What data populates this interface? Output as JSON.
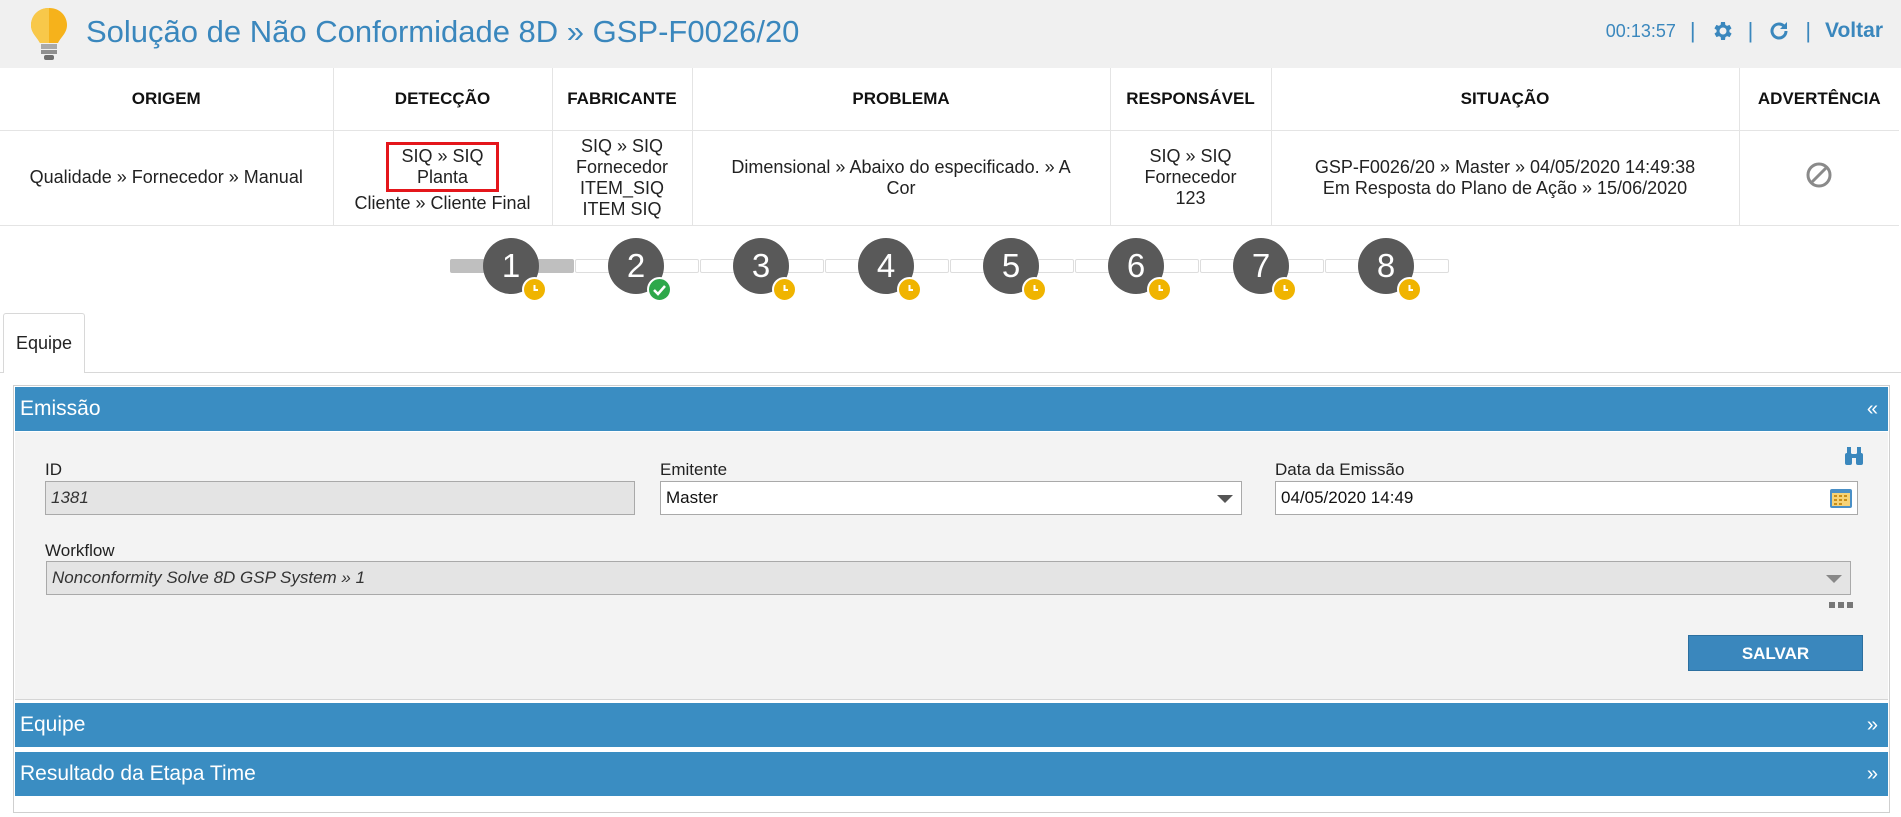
{
  "header": {
    "title": "Solução de Não Conformidade 8D » GSP-F0026/20",
    "timer": "00:13:57",
    "back_label": "Voltar",
    "icons": [
      "lightbulb-icon",
      "gear-icon",
      "refresh-icon"
    ]
  },
  "summary": {
    "columns": [
      "ORIGEM",
      "DETECÇÃO",
      "FABRICANTE",
      "PROBLEMA",
      "RESPONSÁVEL",
      "SITUAÇÃO",
      "ADVERTÊNCIA"
    ],
    "origem": "Qualidade » Fornecedor » Manual",
    "deteccao_line1": "SIQ » SIQ",
    "deteccao_line2": "Planta",
    "deteccao_line3": "Cliente » Cliente Final",
    "fabricante_line1": "SIQ » SIQ",
    "fabricante_line2": "Fornecedor",
    "fabricante_line3": "ITEM_SIQ",
    "fabricante_line4": "ITEM SIQ",
    "problema_line1": "Dimensional » Abaixo do especificado. » A",
    "problema_line2": "Cor",
    "responsavel_line1": "SIQ » SIQ",
    "responsavel_line2": "Fornecedor",
    "responsavel_line3": "123",
    "situacao_line1": "GSP-F0026/20 » Master » 04/05/2020 14:49:38",
    "situacao_line2": "Em Resposta do Plano de Ação » 15/06/2020",
    "advertencia_icon": "blocked-icon"
  },
  "steps": [
    {
      "n": "1",
      "status": "pending"
    },
    {
      "n": "2",
      "status": "done"
    },
    {
      "n": "3",
      "status": "pending"
    },
    {
      "n": "4",
      "status": "pending"
    },
    {
      "n": "5",
      "status": "pending"
    },
    {
      "n": "6",
      "status": "pending"
    },
    {
      "n": "7",
      "status": "pending"
    },
    {
      "n": "8",
      "status": "pending"
    }
  ],
  "tabs": [
    {
      "label": "Equipe"
    }
  ],
  "sections": {
    "emissao": {
      "title": "Emissão",
      "chevron": "«"
    },
    "equipe": {
      "title": "Equipe",
      "chevron": "»"
    },
    "resultado": {
      "title": "Resultado da Etapa Time",
      "chevron": "»"
    }
  },
  "form": {
    "id_label": "ID",
    "id_value": "1381",
    "emitente_label": "Emitente",
    "emitente_value": "Master",
    "data_label": "Data da Emissão",
    "data_value": "04/05/2020 14:49",
    "workflow_label": "Workflow",
    "workflow_value": "Nonconformity Solve 8D GSP System » 1",
    "save_label": "SALVAR"
  },
  "colors": {
    "accent": "#3a87bd",
    "bar": "#3a8dc2",
    "step": "#595959",
    "pending": "#f0b400",
    "done": "#2ea84a",
    "highlight": "#e4161b"
  }
}
